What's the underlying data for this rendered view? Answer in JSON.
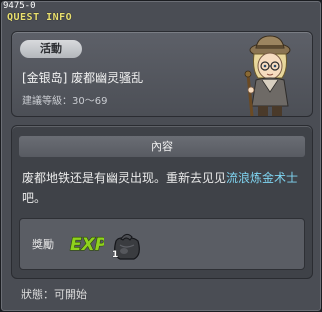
{
  "window": {
    "quest_id": "9475-0",
    "title": "QUEST INFO"
  },
  "quest": {
    "category": "活動",
    "name": "[金银岛] 废都幽灵骚乱",
    "level_label": "建議等級",
    "level_range": "30～69",
    "npc_icon": "explorer-npc-portrait"
  },
  "content": {
    "header": "內容",
    "description_before": "废都地铁还是有幽灵出现。重新去见见",
    "description_highlight": "流浪炼金术士",
    "description_after": "吧。"
  },
  "reward": {
    "label": "獎勵",
    "exp_icon": "exp-icon",
    "item_icon": "item-bag-icon",
    "item_count": "1"
  },
  "status": {
    "label": "狀態",
    "value": "可開始"
  },
  "colors": {
    "title": "#e9e070",
    "highlight": "#7fd4f0",
    "exp": "#8fd21e"
  }
}
